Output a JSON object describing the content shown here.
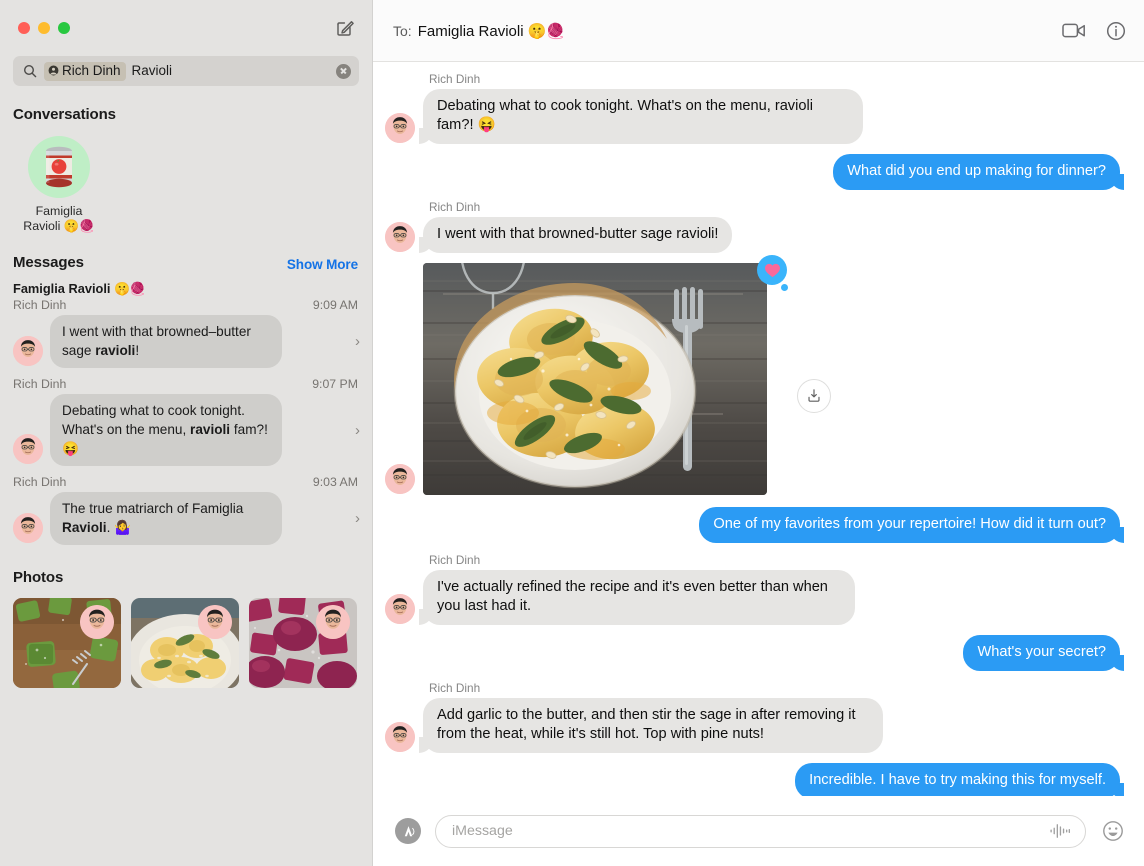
{
  "window": {
    "traffic_lights": [
      "close",
      "minimize",
      "zoom"
    ],
    "compose_icon": "compose-icon"
  },
  "search": {
    "icon": "search-icon",
    "token_label": "Rich Dinh",
    "token_icon": "contact-icon",
    "query_text": "Ravioli",
    "clear_icon": "clear-icon"
  },
  "sidebar": {
    "conversations": {
      "header": "Conversations",
      "items": [
        {
          "name_line1": "Famiglia",
          "name_line2": "Ravioli 🤫🧶",
          "avatar_icon": "tomato-can-icon"
        }
      ]
    },
    "messages": {
      "header": "Messages",
      "show_more": "Show More",
      "results": [
        {
          "title": "Famiglia Ravioli 🤫🧶",
          "sender": "Rich Dinh",
          "time": "9:09 AM",
          "text_pre": "I went with that browned–butter sage ",
          "text_match": "ravioli",
          "text_post": "!",
          "chevron": "chevron-right-icon"
        },
        {
          "title": "",
          "sender": "Rich Dinh",
          "time": "9:07 PM",
          "text_pre": "Debating what to cook tonight. What's on the menu, ",
          "text_match": "ravioli",
          "text_post": " fam?! 😝",
          "chevron": "chevron-right-icon"
        },
        {
          "title": "",
          "sender": "Rich Dinh",
          "time": "9:03 AM",
          "text_pre": "The true matriarch of Famiglia ",
          "text_match": "Ravioli",
          "text_post": ". 🤷‍♀️",
          "chevron": "chevron-right-icon"
        }
      ]
    },
    "photos": {
      "header": "Photos",
      "items": [
        {
          "alt": "green spinach ravioli on wood with fork",
          "badge": "sender-memoji"
        },
        {
          "alt": "plate of yellow ravioli with sage and pine nuts",
          "badge": "sender-memoji"
        },
        {
          "alt": "raw beet ravioli dusted with flour",
          "badge": "sender-memoji"
        }
      ]
    }
  },
  "conversation": {
    "header": {
      "to_label": "To:",
      "recipient": "Famiglia Ravioli 🤫🧶",
      "facetime_icon": "video-camera-icon",
      "info_icon": "info-icon"
    },
    "messages": [
      {
        "type": "text",
        "direction": "incoming",
        "sender": "Rich Dinh",
        "text": "Debating what to cook tonight. What's on the menu, ravioli fam?! 😝"
      },
      {
        "type": "text",
        "direction": "outgoing",
        "sender": "",
        "text": "What did you end up making for dinner?"
      },
      {
        "type": "text",
        "direction": "incoming",
        "sender": "Rich Dinh",
        "text": "I went with that browned-butter sage ravioli!"
      },
      {
        "type": "image",
        "direction": "incoming",
        "sender": "",
        "alt": "plate of browned-butter sage ravioli with a fork on a rustic wooden table",
        "tapback": "heart",
        "download_icon": "download-icon"
      },
      {
        "type": "text",
        "direction": "outgoing",
        "sender": "",
        "text": "One of my favorites from your repertoire! How did it turn out?"
      },
      {
        "type": "text",
        "direction": "incoming",
        "sender": "Rich Dinh",
        "text": "I've actually refined the recipe and it's even better than when you last had it."
      },
      {
        "type": "text",
        "direction": "outgoing",
        "sender": "",
        "text": "What's your secret?"
      },
      {
        "type": "text",
        "direction": "incoming",
        "sender": "Rich Dinh",
        "text": "Add garlic to the butter, and then stir the sage in after removing it from the heat, while it's still hot. Top with pine nuts!"
      },
      {
        "type": "text",
        "direction": "outgoing",
        "sender": "",
        "text": "Incredible. I have to try making this for myself."
      }
    ],
    "composer": {
      "apps_icon": "app-store-icon",
      "placeholder": "iMessage",
      "value": "",
      "audio_icon": "audio-waveform-icon",
      "emoji_icon": "emoji-smiley-icon"
    }
  },
  "colors": {
    "outgoing_bubble": "#2b9bf4",
    "incoming_bubble": "#e6e5e3",
    "sidebar_bg": "#e4e3e1",
    "link": "#1473e6",
    "tapback_bubble": "#3ab4fb",
    "tapback_heart": "#f9689b",
    "conversation_avatar_bg": "#bfeec6"
  }
}
